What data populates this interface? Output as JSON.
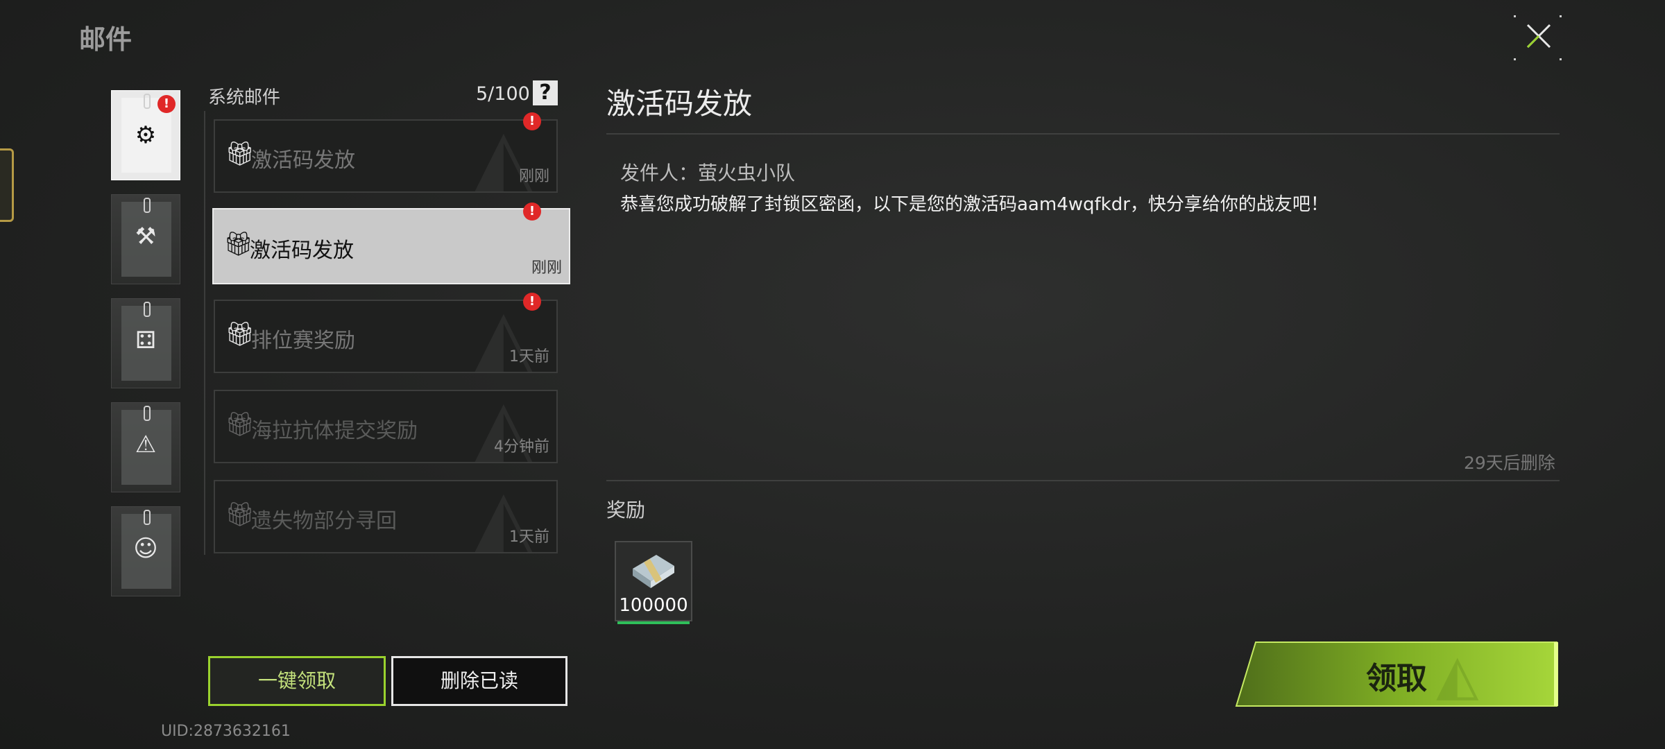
{
  "header": {
    "title": "邮件",
    "close_icon": "close-icon"
  },
  "categories": [
    {
      "icon": "gear-icon",
      "glyph": "⚙",
      "active": true,
      "badge": "!"
    },
    {
      "icon": "hammer-icon",
      "glyph": "⚒",
      "active": false
    },
    {
      "icon": "dice-icon",
      "glyph": "⚃",
      "active": false
    },
    {
      "icon": "warning-icon",
      "glyph": "⚠",
      "active": false
    },
    {
      "icon": "face-icon",
      "glyph": "☺",
      "active": false
    }
  ],
  "list": {
    "label": "系统邮件",
    "count": "5/100",
    "help": "?",
    "items": [
      {
        "title": "激活码发放",
        "time": "刚刚",
        "icon": "gift-icon",
        "unread": true,
        "state": "normal"
      },
      {
        "title": "激活码发放",
        "time": "刚刚",
        "icon": "gift-icon",
        "unread": true,
        "state": "selected"
      },
      {
        "title": "排位赛奖励",
        "time": "1天前",
        "icon": "gift-icon",
        "unread": true,
        "state": "normal"
      },
      {
        "title": "海拉抗体提交奖励",
        "time": "4分钟前",
        "icon": "gift-open-icon",
        "unread": false,
        "state": "read"
      },
      {
        "title": "遗失物部分寻回",
        "time": "1天前",
        "icon": "gift-open-icon",
        "unread": false,
        "state": "read"
      }
    ]
  },
  "actions": {
    "claim_all": "一键领取",
    "delete_read": "删除已读"
  },
  "uid": "UID:2873632161",
  "detail": {
    "title": "激活码发放",
    "sender": "发件人：萤火虫小队",
    "body": "恭喜您成功破解了封锁区密函，以下是您的激活码aam4wqfkdr，快分享给你的战友吧！",
    "expire": "29天后删除",
    "reward_label": "奖励",
    "rewards": [
      {
        "icon": "cash-bundle-icon",
        "amount": "100000"
      }
    ],
    "claim": "领取"
  },
  "colors": {
    "accent": "#9ad22e",
    "badge": "#e02828",
    "selected": "#c9c9c9"
  }
}
